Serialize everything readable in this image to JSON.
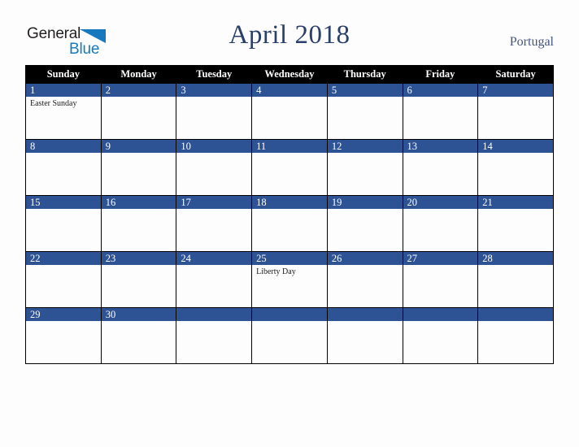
{
  "brand": {
    "name_part1": "General",
    "name_part2": "Blue",
    "triangle_color": "#1878be",
    "text_color": "#231f20"
  },
  "header": {
    "title": "April 2018",
    "location": "Portugal",
    "title_color": "#2b3f6b"
  },
  "calendar": {
    "header_bg": "#000000",
    "daynum_bg": "#2e5395",
    "weekday_headers": [
      "Sunday",
      "Monday",
      "Tuesday",
      "Wednesday",
      "Thursday",
      "Friday",
      "Saturday"
    ],
    "weeks": [
      [
        {
          "day": "1",
          "events": [
            "Easter Sunday"
          ]
        },
        {
          "day": "2",
          "events": []
        },
        {
          "day": "3",
          "events": []
        },
        {
          "day": "4",
          "events": []
        },
        {
          "day": "5",
          "events": []
        },
        {
          "day": "6",
          "events": []
        },
        {
          "day": "7",
          "events": []
        }
      ],
      [
        {
          "day": "8",
          "events": []
        },
        {
          "day": "9",
          "events": []
        },
        {
          "day": "10",
          "events": []
        },
        {
          "day": "11",
          "events": []
        },
        {
          "day": "12",
          "events": []
        },
        {
          "day": "13",
          "events": []
        },
        {
          "day": "14",
          "events": []
        }
      ],
      [
        {
          "day": "15",
          "events": []
        },
        {
          "day": "16",
          "events": []
        },
        {
          "day": "17",
          "events": []
        },
        {
          "day": "18",
          "events": []
        },
        {
          "day": "19",
          "events": []
        },
        {
          "day": "20",
          "events": []
        },
        {
          "day": "21",
          "events": []
        }
      ],
      [
        {
          "day": "22",
          "events": []
        },
        {
          "day": "23",
          "events": []
        },
        {
          "day": "24",
          "events": []
        },
        {
          "day": "25",
          "events": [
            "Liberty Day"
          ]
        },
        {
          "day": "26",
          "events": []
        },
        {
          "day": "27",
          "events": []
        },
        {
          "day": "28",
          "events": []
        }
      ],
      [
        {
          "day": "29",
          "events": []
        },
        {
          "day": "30",
          "events": []
        },
        {
          "day": "",
          "events": []
        },
        {
          "day": "",
          "events": []
        },
        {
          "day": "",
          "events": []
        },
        {
          "day": "",
          "events": []
        },
        {
          "day": "",
          "events": []
        }
      ]
    ]
  }
}
